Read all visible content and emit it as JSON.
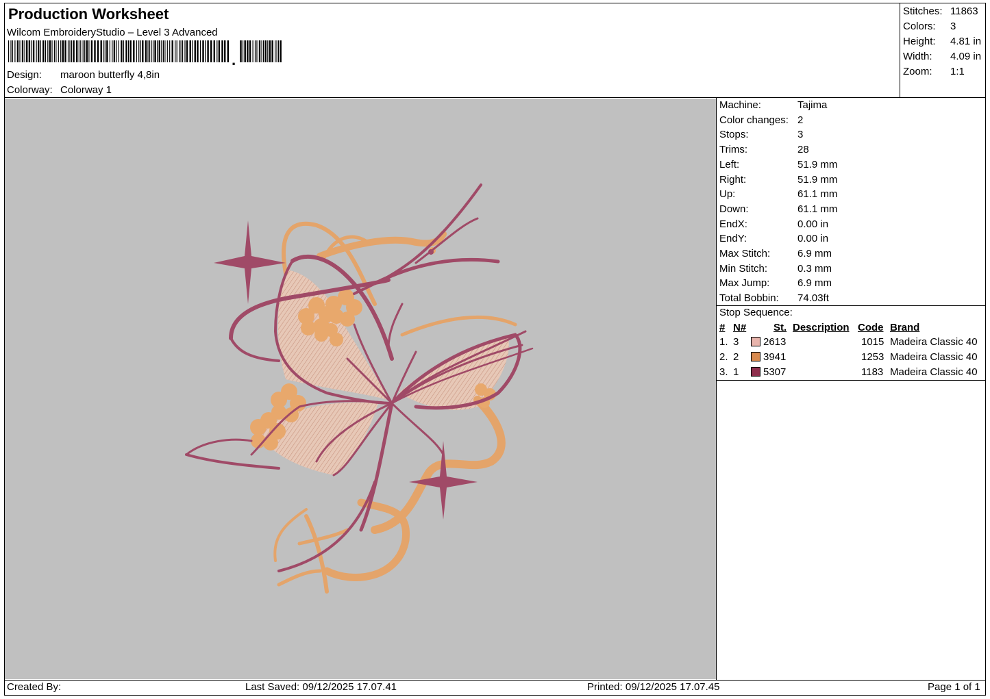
{
  "header": {
    "title": "Production Worksheet",
    "software": "Wilcom EmbroideryStudio – Level 3 Advanced",
    "barcode_suffix": ","
  },
  "design_info": [
    {
      "label": "Design:",
      "value": "maroon butterfly 4,8in"
    },
    {
      "label": "Colorway:",
      "value": "Colorway 1"
    }
  ],
  "stats": [
    {
      "label": "Stitches:",
      "value": "11863"
    },
    {
      "label": "Colors:",
      "value": "3"
    },
    {
      "label": "Height:",
      "value": "4.81 in"
    },
    {
      "label": "Width:",
      "value": "4.09 in"
    },
    {
      "label": "Zoom:",
      "value": "1:1"
    }
  ],
  "machine_info": [
    {
      "label": "Machine:",
      "value": "Tajima"
    },
    {
      "label": "Color changes:",
      "value": "2"
    },
    {
      "label": "Stops:",
      "value": "3"
    },
    {
      "label": "Trims:",
      "value": "28"
    },
    {
      "label": "Left:",
      "value": "51.9 mm"
    },
    {
      "label": "Right:",
      "value": "51.9 mm"
    },
    {
      "label": "Up:",
      "value": "61.1 mm"
    },
    {
      "label": "Down:",
      "value": "61.1 mm"
    },
    {
      "label": "EndX:",
      "value": "0.00 in"
    },
    {
      "label": "EndY:",
      "value": "0.00 in"
    },
    {
      "label": "Max Stitch:",
      "value": "6.9 mm"
    },
    {
      "label": "Min Stitch:",
      "value": "0.3 mm"
    },
    {
      "label": "Max Jump:",
      "value": "6.9 mm"
    },
    {
      "label": "Total Bobbin:",
      "value": "74.03ft"
    }
  ],
  "stop_sequence": {
    "title": "Stop Sequence:",
    "headers": [
      "#",
      "N#",
      "St.",
      "Description",
      "Code",
      "Brand"
    ],
    "rows": [
      {
        "num": "1.",
        "n": "3",
        "color": "#e8b4ac",
        "st": "2613",
        "description": "",
        "code": "1015",
        "brand": "Madeira Classic 40"
      },
      {
        "num": "2.",
        "n": "2",
        "color": "#d98a4e",
        "st": "3941",
        "description": "",
        "code": "1253",
        "brand": "Madeira Classic 40"
      },
      {
        "num": "3.",
        "n": "1",
        "color": "#8e2e4c",
        "st": "5307",
        "description": "",
        "code": "1183",
        "brand": "Madeira Classic 40"
      }
    ]
  },
  "footer": {
    "created_by": "Created By:",
    "last_saved": "Last Saved: 09/12/2025 17.07.41",
    "printed": "Printed: 09/12/2025 17.07.45",
    "page": "Page 1 of 1"
  },
  "colors": {
    "canvas_bg": "#c0c0c0",
    "thread_pink": "#ecc7b4",
    "thread_orange": "#e7a56d",
    "thread_maroon": "#a04a67"
  }
}
